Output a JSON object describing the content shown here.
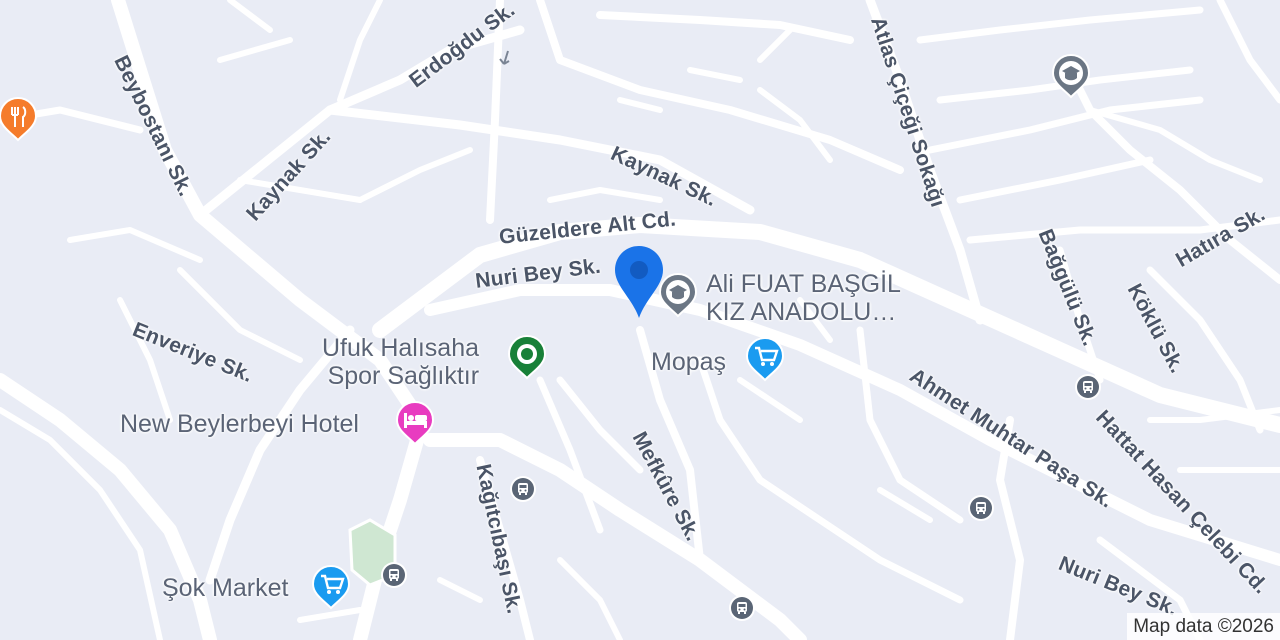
{
  "map": {
    "attribution": "Map data ©2026",
    "streets": {
      "beybostani": "Beybostanı Sk.",
      "erdogdu": "Erdoğdu Sk.",
      "kaynak_left": "Kaynak Sk.",
      "kaynak_right": "Kaynak Sk.",
      "guzeldere": "Güzeldere Alt Cd.",
      "nuri_bey_top": "Nuri Bey Sk.",
      "atlas": "Atlas Çiçeği Sokağı",
      "baggulu": "Bağgülü Sk.",
      "koklu": "Köklü Sk.",
      "hatira": "Hatıra Sk.",
      "enveriye": "Enveriye Sk.",
      "mefkure": "Mefkûre Sk.",
      "kagitcibasi": "Kağıtcıbaşı Sk.",
      "ahmet_muhtar": "Ahmet Muhtar Paşa Sk.",
      "hattat": "Hattat Hasan Çelebi Cd.",
      "nuri_bey_bottom": "Nuri Bey Sk."
    },
    "places": {
      "school_label_line1": "Ali FUAT BAŞGİL",
      "school_label_line2": "KIZ ANADOLU…",
      "mopas": "Mopaş",
      "ufuk_line1": "Ufuk Halısaha",
      "ufuk_line2": "Spor Sağlıktır",
      "hotel": "New Beylerbeyi Hotel",
      "sok_market": "Şok Market"
    },
    "icons": {
      "restaurant": "fork-knife-icon",
      "school": "graduation-cap-icon",
      "shopping": "shopping-cart-icon",
      "park": "park-icon",
      "hotel": "bed-icon",
      "bus": "bus-icon",
      "location": "location-pin-icon"
    },
    "colors": {
      "background": "#e9ecf5",
      "road": "#ffffff",
      "restaurant": "#f57c2b",
      "school": "#6b7684",
      "shopping": "#1a9bf0",
      "park": "#188038",
      "hotel": "#e83cc0",
      "bus": "#5a6575",
      "location": "#1a73e8"
    }
  }
}
